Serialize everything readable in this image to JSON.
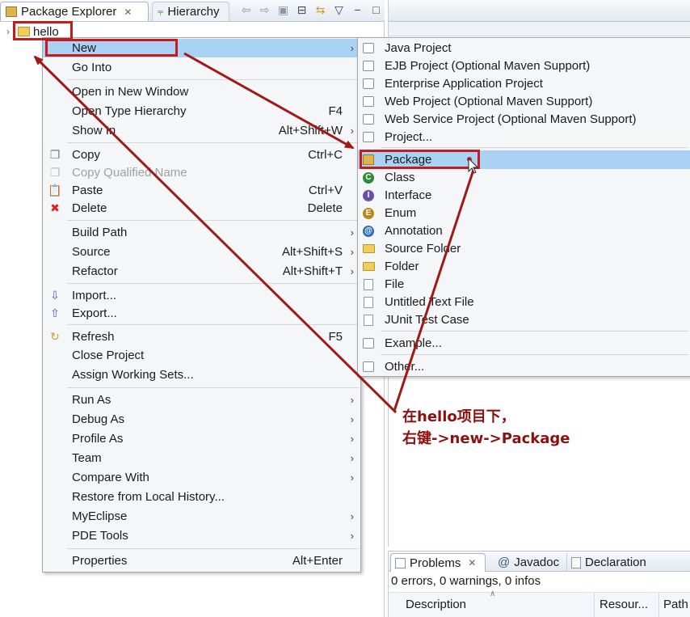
{
  "views": {
    "package_explorer_tab": "Package Explorer",
    "hierarchy_tab": "Hierarchy",
    "close_glyph": "✕"
  },
  "tree": {
    "project": "hello"
  },
  "context_menu": {
    "items": [
      {
        "label": "New",
        "shortcut": "",
        "arrow": true
      },
      {
        "label": "Go Into",
        "shortcut": ""
      },
      {
        "label": "Open in New Window",
        "shortcut": ""
      },
      {
        "label": "Open Type Hierarchy",
        "shortcut": "F4"
      },
      {
        "label": "Show In",
        "shortcut": "Alt+Shift+W",
        "arrow": true
      },
      {
        "label": "Copy",
        "shortcut": "Ctrl+C",
        "icon": "copy-icon"
      },
      {
        "label": "Copy Qualified Name",
        "shortcut": "",
        "icon": "copy-qualified-icon",
        "disabled": true
      },
      {
        "label": "Paste",
        "shortcut": "Ctrl+V",
        "icon": "paste-icon"
      },
      {
        "label": "Delete",
        "shortcut": "Delete",
        "icon": "delete-icon"
      },
      {
        "label": "Build Path",
        "shortcut": "",
        "arrow": true
      },
      {
        "label": "Source",
        "shortcut": "Alt+Shift+S",
        "arrow": true
      },
      {
        "label": "Refactor",
        "shortcut": "Alt+Shift+T",
        "arrow": true
      },
      {
        "label": "Import...",
        "shortcut": "",
        "icon": "import-icon"
      },
      {
        "label": "Export...",
        "shortcut": "",
        "icon": "export-icon"
      },
      {
        "label": "Refresh",
        "shortcut": "F5",
        "icon": "refresh-icon"
      },
      {
        "label": "Close Project",
        "shortcut": ""
      },
      {
        "label": "Assign Working Sets...",
        "shortcut": ""
      },
      {
        "label": "Run As",
        "shortcut": "",
        "arrow": true
      },
      {
        "label": "Debug As",
        "shortcut": "",
        "arrow": true
      },
      {
        "label": "Profile As",
        "shortcut": "",
        "arrow": true
      },
      {
        "label": "Team",
        "shortcut": "",
        "arrow": true
      },
      {
        "label": "Compare With",
        "shortcut": "",
        "arrow": true
      },
      {
        "label": "Restore from Local History...",
        "shortcut": ""
      },
      {
        "label": "MyEclipse",
        "shortcut": "",
        "arrow": true
      },
      {
        "label": "PDE Tools",
        "shortcut": "",
        "arrow": true
      },
      {
        "label": "Properties",
        "shortcut": "Alt+Enter"
      }
    ]
  },
  "submenu": {
    "items": [
      {
        "label": "Java Project",
        "icon": "java-project-icon"
      },
      {
        "label": "EJB Project (Optional Maven Support)",
        "icon": "ejb-project-icon"
      },
      {
        "label": "Enterprise Application Project",
        "icon": "enterprise-project-icon"
      },
      {
        "label": "Web Project (Optional Maven Support)",
        "icon": "web-project-icon"
      },
      {
        "label": "Web Service Project (Optional Maven Support)",
        "icon": "web-service-project-icon"
      },
      {
        "label": "Project...",
        "icon": "project-icon"
      },
      {
        "label": "Package",
        "icon": "package-icon"
      },
      {
        "label": "Class",
        "icon": "class-icon"
      },
      {
        "label": "Interface",
        "icon": "interface-icon"
      },
      {
        "label": "Enum",
        "icon": "enum-icon"
      },
      {
        "label": "Annotation",
        "icon": "annotation-icon"
      },
      {
        "label": "Source Folder",
        "icon": "source-folder-icon"
      },
      {
        "label": "Folder",
        "icon": "folder-icon"
      },
      {
        "label": "File",
        "icon": "file-icon"
      },
      {
        "label": "Untitled Text File",
        "icon": "text-file-icon"
      },
      {
        "label": "JUnit Test Case",
        "icon": "junit-icon"
      },
      {
        "label": "Example...",
        "icon": "example-icon"
      },
      {
        "label": "Other...",
        "icon": "other-icon"
      }
    ]
  },
  "problems_view": {
    "tabs": [
      "Problems",
      "Javadoc",
      "Declaration"
    ],
    "summary": "0 errors, 0 warnings, 0 infos",
    "columns": [
      "Description",
      "Resour...",
      "Path"
    ]
  },
  "annotation": {
    "line1_prefix": "在",
    "line1_bold": "hello",
    "line1_suffix": "项目下，",
    "line2": "右键->new->Package"
  },
  "colors": {
    "highlight_box": "#c41c1c",
    "menu_highlight": "#a9d2f5",
    "annotation_text": "#8b1010",
    "arrow": "#a01818"
  }
}
